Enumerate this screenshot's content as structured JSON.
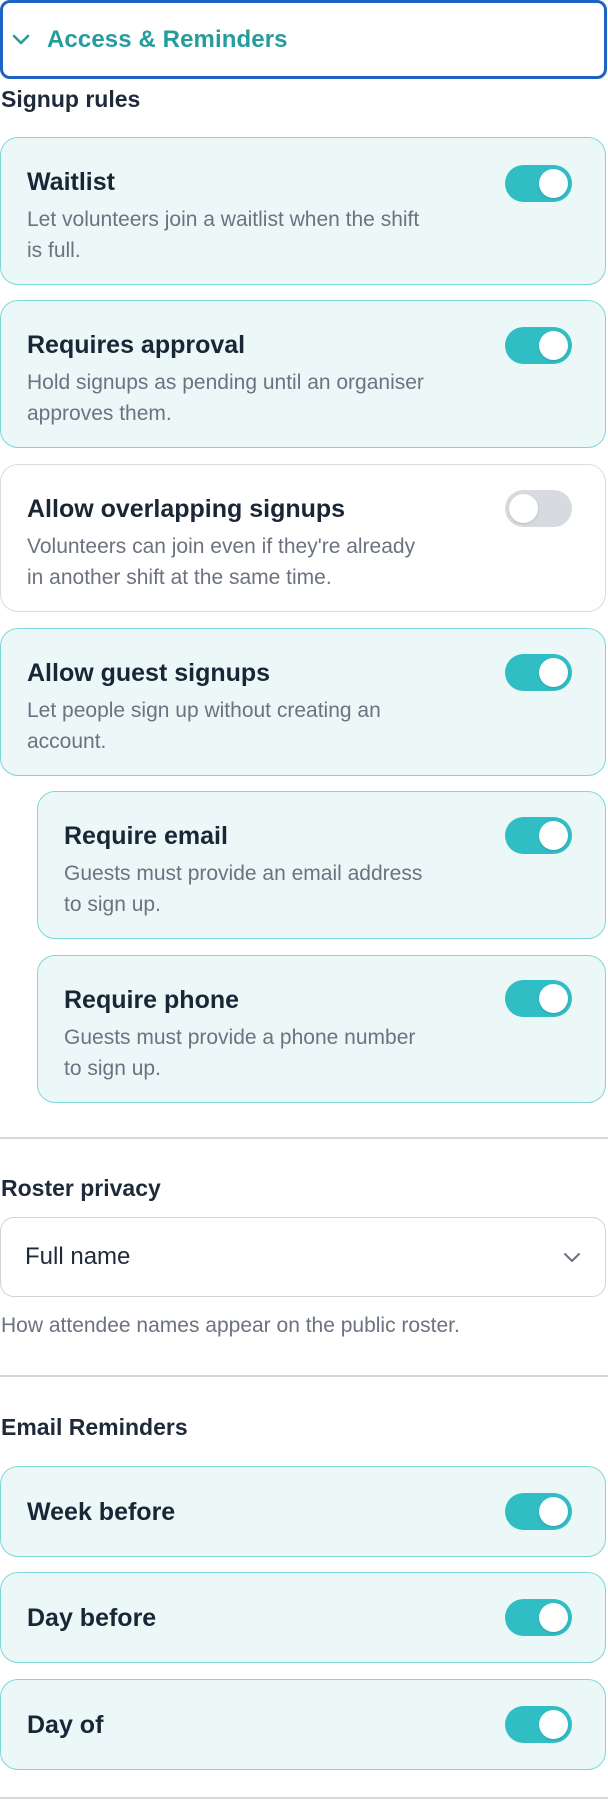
{
  "accordion": {
    "title": "Access & Reminders"
  },
  "signup_rules": {
    "label": "Signup rules",
    "items": [
      {
        "title": "Waitlist",
        "desc_line1": "Let volunteers join a waitlist when the shift",
        "desc_line2": "is full.",
        "enabled": true
      },
      {
        "title": "Requires approval",
        "desc_line1": "Hold signups as pending until an organiser",
        "desc_line2": "approves them.",
        "enabled": true
      },
      {
        "title": "Allow overlapping signups",
        "desc_line1": "Volunteers can join even if they're already",
        "desc_line2": "in another shift at the same time.",
        "enabled": false
      },
      {
        "title": "Allow guest signups",
        "desc_line1": "Let people sign up without creating an",
        "desc_line2": "account.",
        "enabled": true
      },
      {
        "title": "Require email",
        "desc_line1": "Guests must provide an email address",
        "desc_line2": "to sign up.",
        "enabled": true
      },
      {
        "title": "Require phone",
        "desc_line1": "Guests must provide a phone number",
        "desc_line2": "to sign up.",
        "enabled": true
      }
    ]
  },
  "roster_privacy": {
    "label": "Roster privacy",
    "selected": "Full name",
    "helper": "How attendee names appear on the public roster."
  },
  "email_reminders": {
    "label": "Email Reminders",
    "items": [
      {
        "title": "Week before",
        "enabled": true
      },
      {
        "title": "Day before",
        "enabled": true
      },
      {
        "title": "Day of",
        "enabled": true
      }
    ]
  },
  "colors": {
    "accent": "#30bec4",
    "accent_text": "#279c9c",
    "focus_border": "#1d63c4",
    "card_bg": "#ecf8f8",
    "card_border": "#7ed7d7"
  }
}
